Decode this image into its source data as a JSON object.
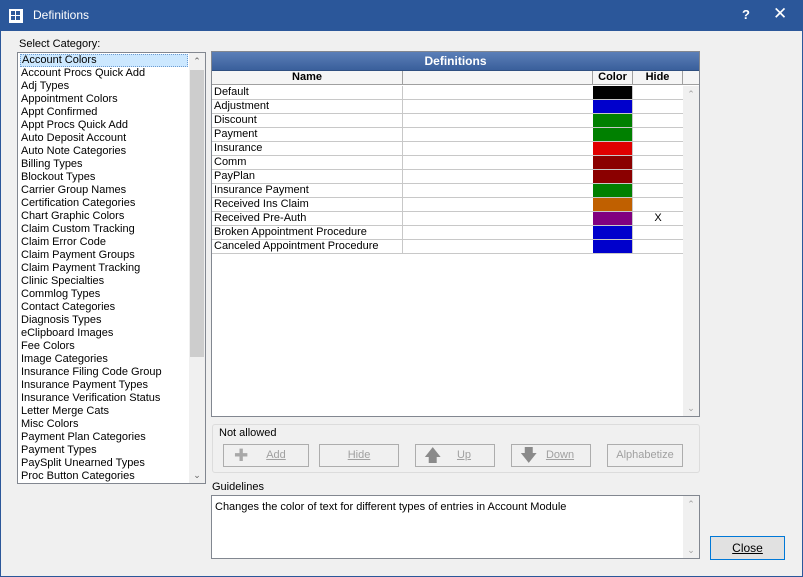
{
  "window": {
    "title": "Definitions",
    "help": "?",
    "close_glyph": "✕"
  },
  "category": {
    "label": "Select Category:",
    "selected": "Account Colors",
    "items": [
      "Account Colors",
      "Account Procs Quick Add",
      "Adj Types",
      "Appointment Colors",
      "Appt Confirmed",
      "Appt Procs Quick Add",
      "Auto Deposit Account",
      "Auto Note Categories",
      "Billing Types",
      "Blockout Types",
      "Carrier Group Names",
      "Certification Categories",
      "Chart Graphic Colors",
      "Claim Custom Tracking",
      "Claim Error Code",
      "Claim Payment Groups",
      "Claim Payment Tracking",
      "Clinic Specialties",
      "Commlog Types",
      "Contact Categories",
      "Diagnosis Types",
      "eClipboard Images",
      "Fee Colors",
      "Image Categories",
      "Insurance Filing Code Group",
      "Insurance Payment Types",
      "Insurance Verification Status",
      "Letter Merge Cats",
      "Misc Colors",
      "Payment Plan Categories",
      "Payment Types",
      "PaySplit Unearned Types",
      "Proc Button Categories"
    ]
  },
  "definitions": {
    "title": "Definitions",
    "columns": {
      "name": "Name",
      "color": "Color",
      "hide": "Hide"
    },
    "rows": [
      {
        "name": "Default",
        "color": "#000000",
        "hide": ""
      },
      {
        "name": "Adjustment",
        "color": "#0000cc",
        "hide": ""
      },
      {
        "name": "Discount",
        "color": "#008000",
        "hide": ""
      },
      {
        "name": "Payment",
        "color": "#008000",
        "hide": ""
      },
      {
        "name": "Insurance",
        "color": "#e00000",
        "hide": ""
      },
      {
        "name": "Comm",
        "color": "#8b0000",
        "hide": ""
      },
      {
        "name": "PayPlan",
        "color": "#8b0000",
        "hide": ""
      },
      {
        "name": "Insurance Payment",
        "color": "#008000",
        "hide": ""
      },
      {
        "name": "Received Ins Claim",
        "color": "#c06000",
        "hide": ""
      },
      {
        "name": "Received Pre-Auth",
        "color": "#800080",
        "hide": "X"
      },
      {
        "name": "Broken Appointment Procedure",
        "color": "#0000cc",
        "hide": ""
      },
      {
        "name": "Canceled Appointment Procedure",
        "color": "#0000cc",
        "hide": ""
      }
    ]
  },
  "actions": {
    "group_label": "Not allowed",
    "add": "Add",
    "hide": "Hide",
    "up": "Up",
    "down": "Down",
    "alphabetize": "Alphabetize"
  },
  "guidelines": {
    "label": "Guidelines",
    "text": "Changes the color of text for different types of entries in Account Module"
  },
  "close_button": "Close"
}
